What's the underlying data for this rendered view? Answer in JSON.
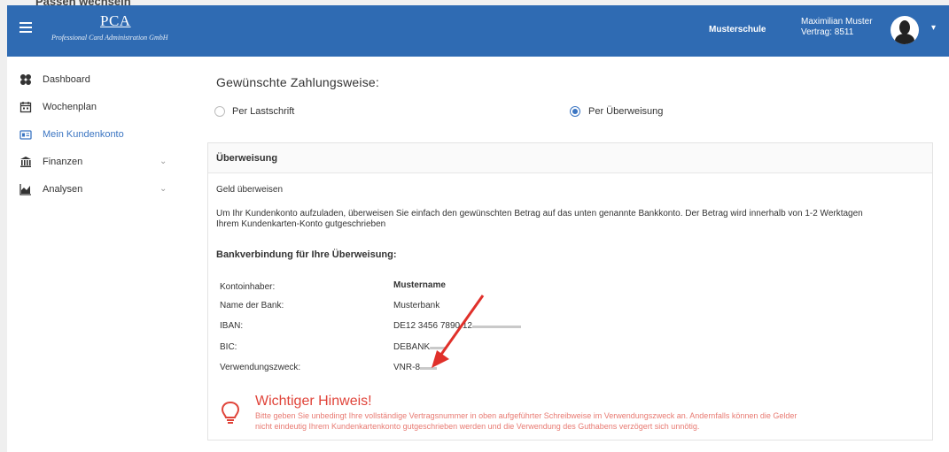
{
  "scan": {
    "title": "Passen wechseln"
  },
  "header": {
    "logo_mark": "PCA",
    "logo_sub": "Professional Card Administration GmbH",
    "school": "Musterschule",
    "user_name": "Maximilian Muster",
    "user_contract": "Vertrag: 8511"
  },
  "sidebar": {
    "items": [
      {
        "label": "Dashboard",
        "icon": "dashboard-icon"
      },
      {
        "label": "Wochenplan",
        "icon": "calendar-icon"
      },
      {
        "label": "Mein Kundenkonto",
        "icon": "id-card-icon"
      },
      {
        "label": "Finanzen",
        "icon": "bank-icon"
      },
      {
        "label": "Analysen",
        "icon": "area-chart-icon"
      }
    ],
    "active_index": 2
  },
  "payment": {
    "title": "Gewünschte Zahlungsweise:",
    "option_debit": "Per Lastschrift",
    "option_transfer": "Per Überweisung",
    "selected": "Per Überweisung"
  },
  "card": {
    "heading": "Überweisung",
    "sub_heading": "Geld überweisen",
    "description_line1": "Um Ihr Kundenkonto aufzuladen, überweisen Sie einfach den gewünschten Betrag auf das unten genannte Bankkonto. Der Betrag wird innerhalb von 1-2 Werktagen",
    "description_line2": "Ihrem Kundenkarten-Konto gutgeschrieben",
    "bank_title": "Bankverbindung für Ihre Überweisung:",
    "rows": [
      {
        "label": "Kontoinhaber:",
        "value": "Mustername"
      },
      {
        "label": "Name der Bank:",
        "value": "Musterbank"
      },
      {
        "label": "IBAN:",
        "value": "DE12 3456 7890 12"
      },
      {
        "label": "BIC:",
        "value": "DEBANK"
      },
      {
        "label": "Verwendungszweck:",
        "value": "VNR-8"
      }
    ]
  },
  "hint": {
    "title": "Wichtiger Hinweis!",
    "body_line1": "Bitte geben Sie unbedingt Ihre vollständige Vertragsnummer in oben aufgeführter Schreibweise im Verwendungszweck an. Andernfalls können die Gelder",
    "body_line2": "nicht eindeutig Ihrem Kundenkartenkonto gutgeschrieben werden und die Verwendung des Guthabens verzögert sich unnötig."
  },
  "colors": {
    "header": "#2f6bb3",
    "accent": "#3b75c2",
    "warning": "#e0443a"
  }
}
